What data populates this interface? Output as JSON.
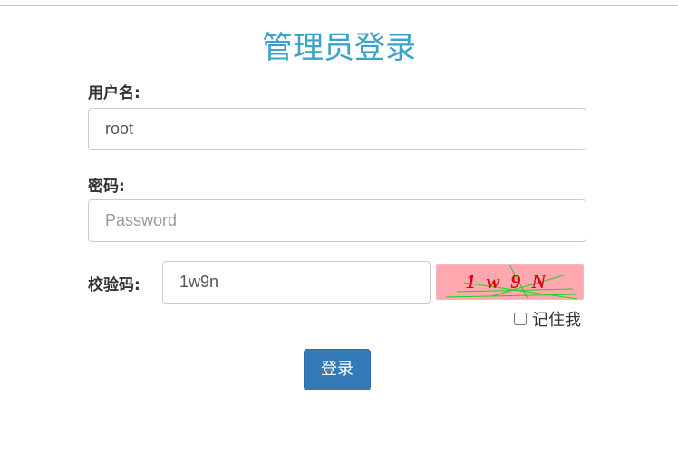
{
  "page": {
    "title": "管理员登录"
  },
  "form": {
    "username": {
      "label": "用户名:",
      "value": "root"
    },
    "password": {
      "label": "密码:",
      "placeholder": "Password",
      "value": ""
    },
    "captcha": {
      "label": "校验码:",
      "value": "1w9n",
      "image_text": "1w9N",
      "image_bg": "#ffa8b0"
    },
    "remember": {
      "label": "记住我",
      "checked": false
    },
    "submit_label": "登录"
  },
  "colors": {
    "title": "#3ba3c9",
    "button": "#337ab7"
  }
}
